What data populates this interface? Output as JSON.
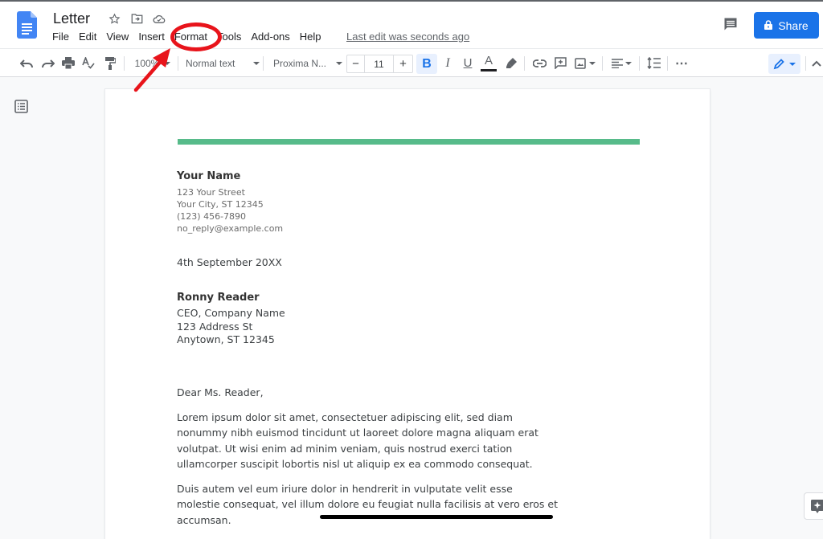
{
  "app": {
    "title": "Letter",
    "accent_color": "#1a73e8",
    "brand_color": "#4285f4"
  },
  "header": {
    "title_icons": [
      "star-icon",
      "move-to-folder-icon",
      "cloud-saved-icon"
    ],
    "menu": [
      "File",
      "Edit",
      "View",
      "Insert",
      "Format",
      "Tools",
      "Add-ons",
      "Help"
    ],
    "last_edit": "Last edit was seconds ago",
    "share_label": "Share"
  },
  "toolbar": {
    "zoom": "100%",
    "style": "Normal text",
    "font": "Proxima N...",
    "font_size": "11",
    "decrease_label": "−",
    "increase_label": "+",
    "bold_label": "B",
    "italic_label": "I",
    "underline_label": "U",
    "text_color_label": "A",
    "more_label": "⋯"
  },
  "annotation": {
    "highlighted_menu": "Format",
    "color": "#e8141b"
  },
  "document": {
    "accent_bar_color": "#57bb8a",
    "sender": {
      "name": "Your Name",
      "street": "123 Your Street",
      "city": "Your City, ST 12345",
      "phone": "(123) 456-7890",
      "email": "no_reply@example.com"
    },
    "date": "4th September 20XX",
    "recipient": {
      "name": "Ronny Reader",
      "title": "CEO, Company Name",
      "street": "123 Address St",
      "city": "Anytown, ST 12345"
    },
    "salutation": "Dear Ms. Reader,",
    "paragraphs": [
      "Lorem ipsum dolor sit amet, consectetuer adipiscing elit, sed diam nonummy nibh euismod tincidunt ut laoreet dolore magna aliquam erat volutpat. Ut wisi enim ad minim veniam, quis nostrud exerci tation ullamcorper suscipit lobortis nisl ut aliquip ex ea commodo consequat.",
      "Duis autem vel eum iriure dolor in hendrerit in vulputate velit esse molestie consequat, vel illum dolore eu feugiat nulla facilisis at vero eros et accumsan."
    ]
  }
}
